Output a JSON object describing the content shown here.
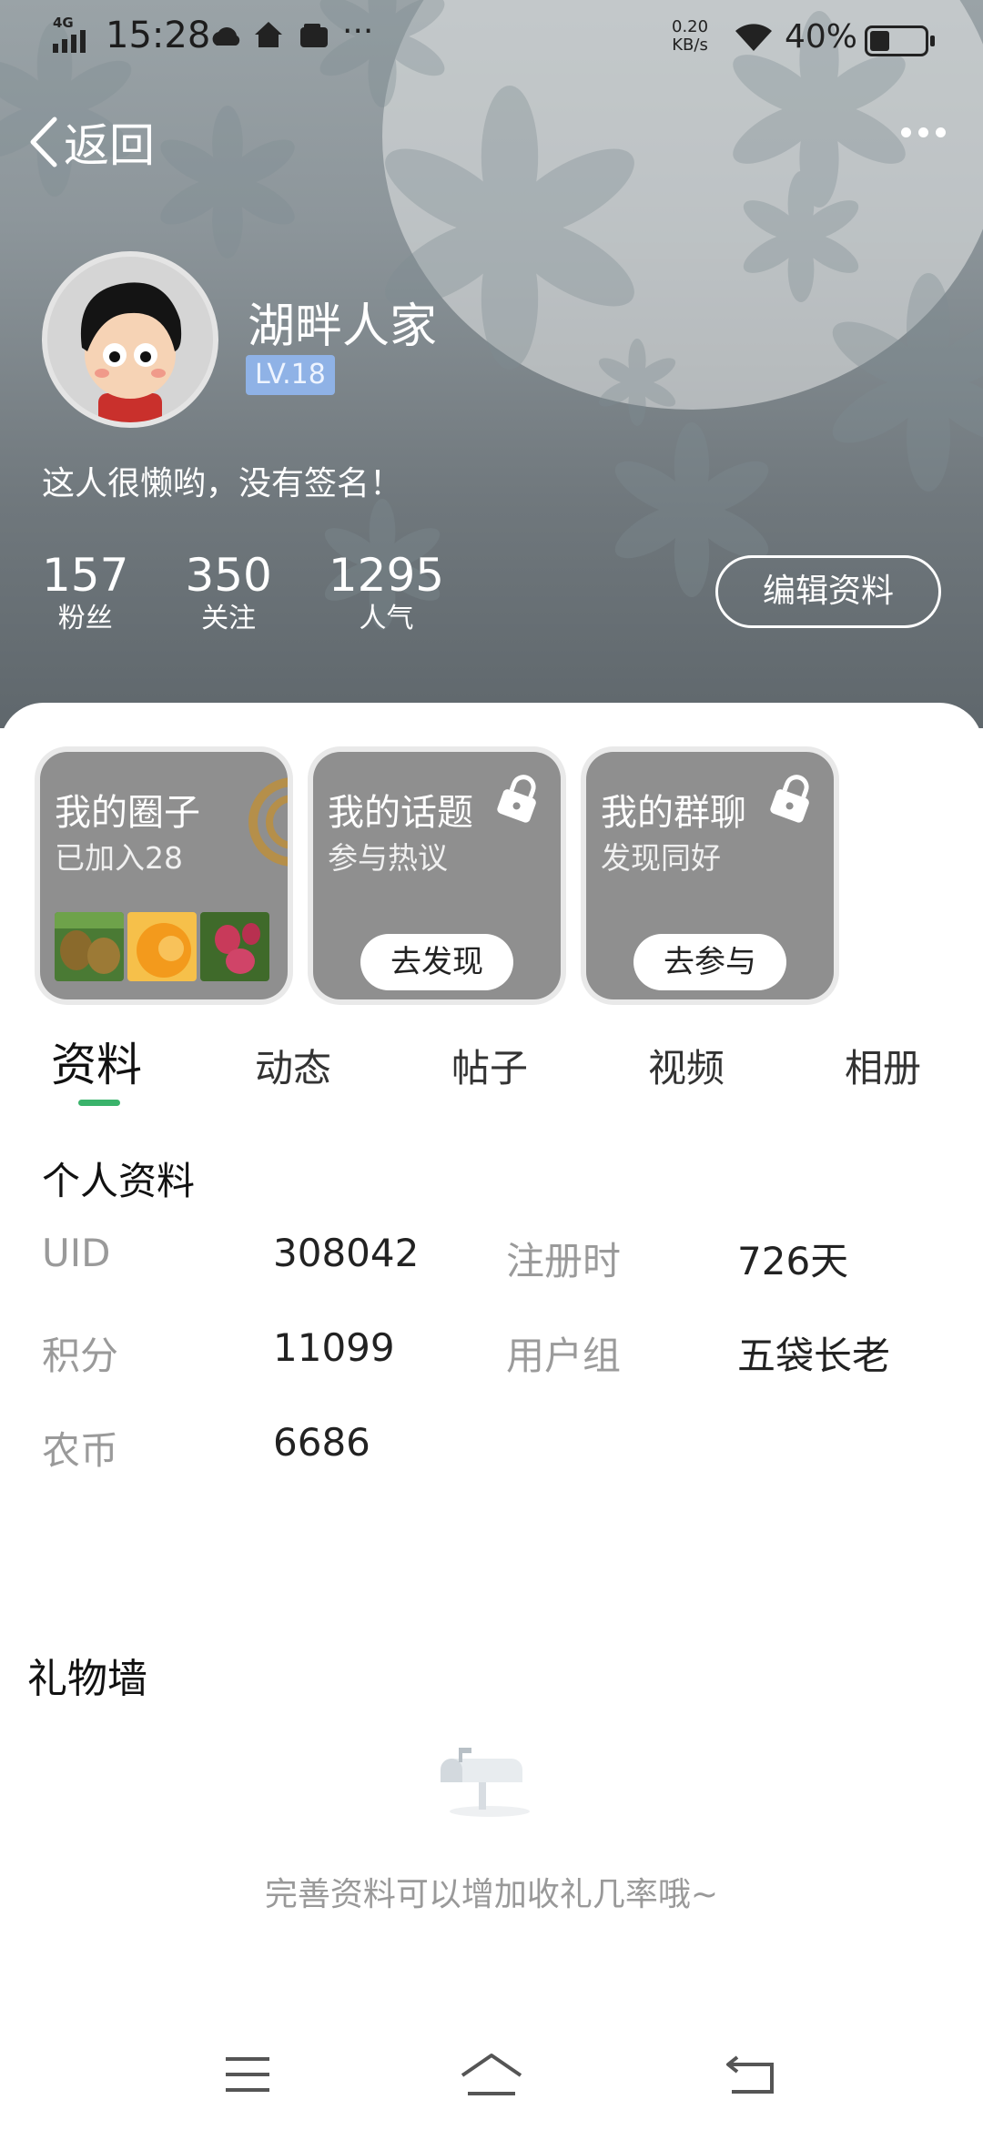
{
  "status_bar": {
    "network": "4G",
    "time": "15:28",
    "net_speed": "0.20",
    "net_speed_unit": "KB/s",
    "battery_text": "40%",
    "battery_level": 0.4
  },
  "header": {
    "back_label": "返回",
    "username": "湖畔人家",
    "level": "LV.18",
    "signature": "这人很懒哟，没有签名！",
    "stats": [
      {
        "value": "157",
        "label": "粉丝"
      },
      {
        "value": "350",
        "label": "关注"
      },
      {
        "value": "1295",
        "label": "人气"
      }
    ],
    "edit_button": "编辑资料"
  },
  "cards": [
    {
      "title": "我的圈子",
      "subtitle": "已加入28"
    },
    {
      "title": "我的话题",
      "subtitle": "参与热议",
      "button": "去发现"
    },
    {
      "title": "我的群聊",
      "subtitle": "发现同好",
      "button": "去参与"
    }
  ],
  "tabs": [
    "资料",
    "动态",
    "帖子",
    "视频",
    "相册"
  ],
  "profile": {
    "title": "个人资料",
    "rows": [
      {
        "k1": "UID",
        "v1": "308042",
        "k2": "注册时",
        "v2": "726天"
      },
      {
        "k1": "积分",
        "v1": "11099",
        "k2": "用户组",
        "v2": "五袋长老"
      },
      {
        "k1": "农币",
        "v1": "6686",
        "k2": "",
        "v2": ""
      }
    ]
  },
  "gift_wall": {
    "title": "礼物墙",
    "hint": "完善资料可以增加收礼几率哦~"
  },
  "colors": {
    "accent": "#3ab36b",
    "level_badge": "#8fb2e6",
    "card_bg": "#8f8f8f"
  }
}
